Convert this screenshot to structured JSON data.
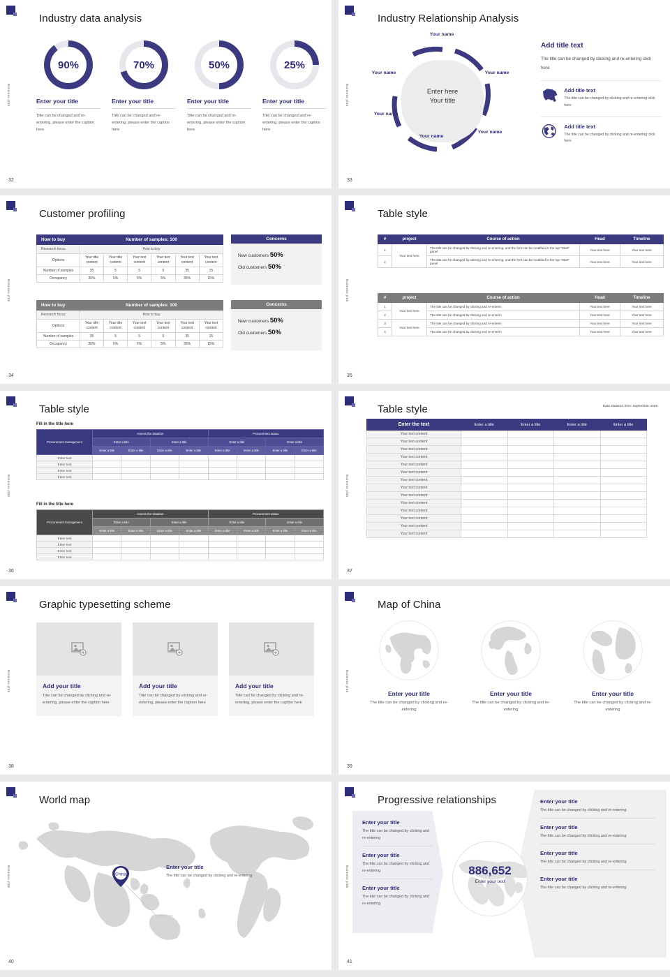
{
  "theme": {
    "navy": "#2d2d7a",
    "header_blue": "#3b3a80",
    "gray_header": "#7c7c7c",
    "light_gray": "#e4e4e4"
  },
  "common": {
    "sidebar_label": "Business plan",
    "logo_glyph": "P"
  },
  "slides": [
    {
      "page": "32",
      "title": "Industry data analysis",
      "donuts": [
        {
          "percent": "90%",
          "value": 90,
          "title": "Enter your title",
          "caption": "Title can be changed and re-entering, please enter the caption here"
        },
        {
          "percent": "70%",
          "value": 70,
          "title": "Enter your title",
          "caption": "Title can be changed and re-entering, please enter the caption here"
        },
        {
          "percent": "50%",
          "value": 50,
          "title": "Enter your title",
          "caption": "Title can be changed and re-entering, please enter the caption here"
        },
        {
          "percent": "25%",
          "value": 25,
          "title": "Enter your title",
          "caption": "Title can be changed and re-entering, please enter the caption here"
        }
      ]
    },
    {
      "page": "33",
      "title": "Industry Relationship Analysis",
      "center_line1": "Enter here",
      "center_line2": "Your title",
      "node_labels": [
        "Your name",
        "Your name",
        "Your name",
        "Your name",
        "Your name",
        "Your name"
      ],
      "right": {
        "heading": "Add title text",
        "lead": "The title can be changed by clicking and re-entering click here",
        "items": [
          {
            "icon": "china-map-icon",
            "title": "Add title text",
            "text": "The title can be changed by clicking and re-entering click here"
          },
          {
            "icon": "globe-icon",
            "title": "Add title text",
            "text": "The title can be changed by clicking and re-entering click here"
          }
        ]
      }
    },
    {
      "page": "34",
      "title": "Customer profiling",
      "tables": [
        {
          "header_left": "How to buy",
          "header_right": "Number of samples: 100",
          "sub_left": "Research focus",
          "sub_right": "How to buy",
          "row_labels": [
            "Options",
            "Number of samples",
            "Occupancy"
          ],
          "options": [
            "Your title content",
            "Your title content",
            "Your text content",
            "Your text content",
            "Your text content",
            "Your text content"
          ],
          "samples": [
            "35",
            "5",
            "5",
            "5",
            "35",
            "15"
          ],
          "occupancy": [
            "35%",
            "5%",
            "5%",
            "5%",
            "35%",
            "15%"
          ]
        },
        {
          "header_left": "How to buy",
          "header_right": "Number of samples: 100",
          "sub_left": "Research focus",
          "sub_right": "How to buy",
          "row_labels": [
            "Options",
            "Number of samples",
            "Occupancy"
          ],
          "options": [
            "Your title content",
            "Your title content",
            "Your text content",
            "Your text content",
            "Your text content",
            "Your text content"
          ],
          "samples": [
            "35",
            "5",
            "5",
            "5",
            "35",
            "15"
          ],
          "occupancy": [
            "35%",
            "5%",
            "5%",
            "5%",
            "35%",
            "15%"
          ]
        }
      ],
      "concerns": [
        {
          "header": "Concerns",
          "lines": [
            {
              "label": "New customers",
              "value": "50%"
            },
            {
              "label": "Old customers",
              "value": "50%"
            }
          ]
        },
        {
          "header": "Concerns",
          "lines": [
            {
              "label": "New customers",
              "value": "50%"
            },
            {
              "label": "Old customers",
              "value": "50%"
            }
          ]
        }
      ]
    },
    {
      "page": "35",
      "title": "Table style",
      "table_top": {
        "columns": [
          "#",
          "project",
          "Course of action",
          "Head",
          "Timeline"
        ],
        "project_cell": "Your text here",
        "rows": [
          {
            "num": "1",
            "action": "The title can be changed by clicking and re-entering, and the font can be modified in the top \"Start\" panel",
            "head": "Your text here",
            "timeline": "Your text here"
          },
          {
            "num": "2",
            "action": "The title can be changed by clicking and re-entering, and the font can be modified in the top \"Start\" panel",
            "head": "Your text here",
            "timeline": "Your text here"
          }
        ]
      },
      "table_bottom": {
        "columns": [
          "#",
          "project",
          "Course of action",
          "Head",
          "Timeline"
        ],
        "project_cells": [
          "Your text here",
          "Your text here"
        ],
        "rows": [
          {
            "num": "1",
            "action": "The title can be changed by clicking and re-enterin",
            "head": "Your text here",
            "timeline": "Your text here"
          },
          {
            "num": "2",
            "action": "The title can be changed by clicking and re-enterin",
            "head": "Your text here",
            "timeline": "Your text here"
          },
          {
            "num": "3",
            "action": "The title can be changed by clicking and re-enterin",
            "head": "Your text here",
            "timeline": "Your text here"
          },
          {
            "num": "4",
            "action": "The title can be changed by clicking and re-enterin",
            "head": "Your text here",
            "timeline": "Your text here"
          }
        ]
      }
    },
    {
      "page": "36",
      "title": "Table style",
      "blocks": [
        {
          "caption": "Fill in the title here",
          "side_header": "Procurement management",
          "group_headers": [
            "Assess the situation",
            "Procurement status"
          ],
          "sub_headers": [
            "Enter a title",
            "Enter a title",
            "Enter a title",
            "Enter a title"
          ],
          "leaf_headers": [
            "Enter a title",
            "Enter a title",
            "Enter a title",
            "Enter a title",
            "Enter a title",
            "Enter a title",
            "Enter a title",
            "Enter a title"
          ],
          "row_labels": [
            "Enter text",
            "Enter text",
            "Enter text",
            "Enter text"
          ]
        },
        {
          "caption": "Fill in the title here",
          "side_header": "Procurement management",
          "group_headers": [
            "Assess the situation",
            "Procurement status"
          ],
          "sub_headers": [
            "Enter a title",
            "Enter a title",
            "Enter a title",
            "Enter a title"
          ],
          "leaf_headers": [
            "Enter a title",
            "Enter a title",
            "Enter a title",
            "Enter a title",
            "Enter a title",
            "Enter a title",
            "Enter a title",
            "Enter a title"
          ],
          "row_labels": [
            "Enter text",
            "Enter text",
            "Enter text",
            "Enter text"
          ]
        }
      ]
    },
    {
      "page": "37",
      "title": "Table style",
      "note": "Data statistics time: September 2029",
      "columns": [
        "Enter the text",
        "Enter a title",
        "Enter a title",
        "Enter a title",
        "Enter a title"
      ],
      "rows": [
        "Your text content",
        "Your text content",
        "Your text content",
        "Your text content",
        "Your text content",
        "Your text content",
        "Your text content",
        "Your text content",
        "Your text content",
        "Your text content",
        "Your text content",
        "Your text content",
        "Your text content",
        "Your text content"
      ]
    },
    {
      "page": "38",
      "title": "Graphic typesetting scheme",
      "cards": [
        {
          "icon": "image-placeholder-icon",
          "title": "Add your title",
          "text": "Title can be changed by clicking and re-entering, please enter the caption here"
        },
        {
          "icon": "image-placeholder-icon",
          "title": "Add your title",
          "text": "Title can be changed by clicking and re-entering, please enter the caption here"
        },
        {
          "icon": "image-placeholder-icon",
          "title": "Add your title",
          "text": "Title can be changed by clicking and re-entering, please enter the caption here"
        }
      ]
    },
    {
      "page": "39",
      "title": "Map of China",
      "globes": [
        {
          "icon": "globe-europe-africa-icon",
          "title": "Enter your title",
          "text": "The title can be changed by clicking and re-entering"
        },
        {
          "icon": "globe-americas-icon",
          "title": "Enter your title",
          "text": "The title can be changed by clicking and re-entering"
        },
        {
          "icon": "globe-atlantic-icon",
          "title": "Enter your title",
          "text": "The title can be changed by clicking and re-entering"
        }
      ]
    },
    {
      "page": "40",
      "title": "World map",
      "pin_label": "China",
      "callout": {
        "title": "Enter your title",
        "text": "The title can be changed by clicking and re-entering"
      }
    },
    {
      "page": "41",
      "title": "Progressive relationships",
      "big_number": "886,652",
      "big_sub": "Enter your text",
      "left_entries": [
        {
          "title": "Enter your title",
          "text": "The title can be changed by clicking and re-entering"
        },
        {
          "title": "Enter your title",
          "text": "The title can be changed by clicking and re-entering"
        },
        {
          "title": "Enter your title",
          "text": "The title can be changed by clicking and re-entering"
        }
      ],
      "right_entries": [
        {
          "title": "Enter your title",
          "text": "The title can be changed by clicking and re-entering"
        },
        {
          "title": "Enter your title",
          "text": "The title can be changed by clicking and re-entering"
        },
        {
          "title": "Enter your title",
          "text": "The title can be changed by clicking and re-entering"
        },
        {
          "title": "Enter your title",
          "text": "The title can be changed by clicking and re-entering"
        }
      ]
    }
  ]
}
